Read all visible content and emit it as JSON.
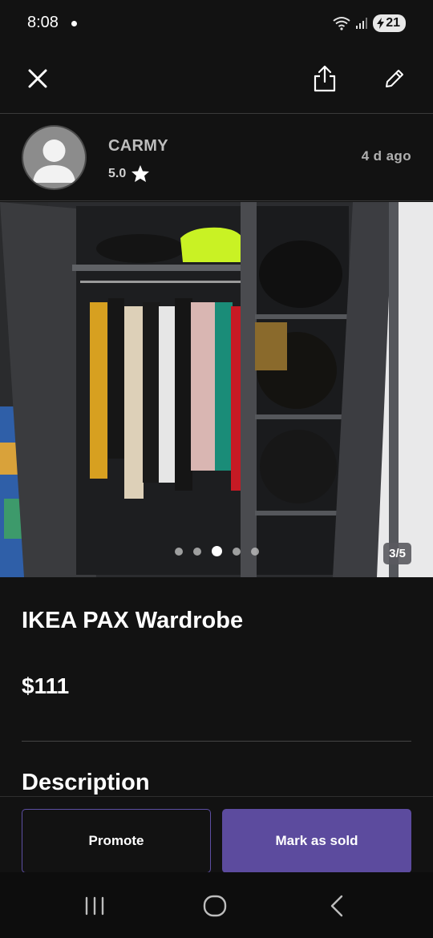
{
  "status_bar": {
    "time": "8:08",
    "battery": "21"
  },
  "toolbar": {
    "close_icon": "close-icon",
    "share_icon": "share-icon",
    "edit_icon": "pencil-icon"
  },
  "seller": {
    "name": "CARMY",
    "rating": "5.0",
    "posted": "4 d ago"
  },
  "gallery": {
    "counter": "3/5",
    "total": 5,
    "active_index": 3
  },
  "listing": {
    "title": "IKEA PAX Wardrobe",
    "price": "$111",
    "description_heading": "Description"
  },
  "actions": {
    "promote_label": "Promote",
    "mark_sold_label": "Mark as sold"
  },
  "colors": {
    "background": "#121212",
    "accent": "#5c4b9e",
    "promote_border": "#5d4fa3"
  }
}
